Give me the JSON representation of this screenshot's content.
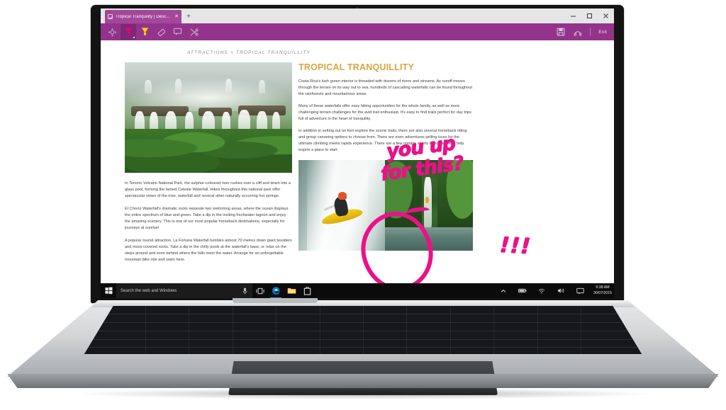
{
  "browser": {
    "tab": {
      "title": "Tropical Tranquility | Desc...",
      "favicon_icon": "page-favicon-icon",
      "close_icon": "close-icon"
    },
    "new_tab_label": "+",
    "window_controls": [
      {
        "name": "minimize",
        "icon": "minimize-icon"
      },
      {
        "name": "maximize",
        "icon": "maximize-icon"
      },
      {
        "name": "close",
        "icon": "close-icon"
      }
    ],
    "ink_toolbar": {
      "tools": [
        {
          "name": "touch-writing",
          "icon": "touch-writing-icon",
          "active": false
        },
        {
          "name": "pen",
          "icon": "pen-icon",
          "active": true,
          "color": "#e5007e"
        },
        {
          "name": "highlighter",
          "icon": "highlighter-icon",
          "active": false,
          "color": "#f4d400"
        },
        {
          "name": "eraser",
          "icon": "eraser-icon",
          "active": false
        },
        {
          "name": "add-note",
          "icon": "note-icon",
          "active": false
        },
        {
          "name": "clip",
          "icon": "clip-icon",
          "active": false
        }
      ],
      "save_icon": "save-icon",
      "share_icon": "share-icon",
      "exit_label": "Exit",
      "bar_color": "#93348c"
    }
  },
  "page": {
    "breadcrumb": "ATTRACTIONS  >  TROPICAL TRANQUILLITY",
    "title": "TROPICAL TRANQUILLITY",
    "title_color": "#d9a441",
    "hero_image_alt": "panoramic tropical waterfalls in rainforest",
    "right_paragraphs": [
      "Costa Rica's lush green interior is threaded with dozens of rivers and streams. As runoff moves through the terrain on its way out to sea, hundreds of cascading waterfalls can be found throughout the rainforests and mountainous areas.",
      "Many of these waterfalls offer easy hiking opportunities for the whole family, as well as more challenging terrain challenges for the avid trail enthusiast. It's easy to find trails perfect for day trips full of adventure in the heart of tranquility.",
      "In addition to setting out on foot explore the scenic trails, there are also several horseback riding and group canoeing options to choose from. There are even adventures pelling tours for the ultimate climbing meets rapids experience. There are a few notable sports listed bellow to help inspire a place to start"
    ],
    "left_paragraphs": [
      "In Tenorio Volcano National Park, the sulphur-coloured river rushes over a cliff and down into a glass pool, forming the famed Celeste Waterfall. Hikes throughout this national park offer spectacular views of the river, waterfall and several other naturally occurring hot springs.",
      "El Chorro Waterfall's dramatic rocks separate two swimming areas, where the ocean displays the entire spectrum of blue and green. Take a dip in the inviting freshwater lagoon and enjoy the amazing scenery. This is one of our most popular horseback destinations, especially for journeys at sunrise!",
      "A popular tourist attraction, La Fortuna Waterfall tumbles almost 70 metres down giant boulders and moss-covered rocks. Take a dip in the chilly pools at the waterfall's base, or relax on the steps around and even behind where the falls meet the water. Arrange for an unforgettable mountain bike ride and swim here."
    ],
    "photos": [
      {
        "name": "kayaker-waterfall-photo",
        "alt": "kayaker dropping over a waterfall"
      },
      {
        "name": "gorge-waterfall-photo",
        "alt": "waterfall in a green gorge"
      }
    ]
  },
  "annotations": {
    "ink_color": "#ec1089",
    "line1": "you up",
    "line2": "for this?",
    "exclaims": "!!!",
    "circle_name": "ink-circle-around-kayaker"
  },
  "taskbar": {
    "start_icon": "windows-start-icon",
    "search_placeholder": "Search the web and Windows",
    "mic_icon": "microphone-icon",
    "task_view_icon": "task-view-icon",
    "apps": [
      {
        "name": "edge",
        "icon": "edge-icon",
        "open": true
      },
      {
        "name": "file-explorer",
        "icon": "folder-icon",
        "open": false
      },
      {
        "name": "store",
        "icon": "store-icon",
        "open": false
      }
    ],
    "tray": [
      {
        "name": "show-hidden-icons",
        "icon": "chevron-up-icon"
      },
      {
        "name": "battery",
        "icon": "battery-icon"
      },
      {
        "name": "network",
        "icon": "wifi-icon"
      },
      {
        "name": "volume",
        "icon": "speaker-icon"
      },
      {
        "name": "action-center",
        "icon": "action-center-icon"
      }
    ],
    "time": "6:38 AM",
    "date": "30/07/2015"
  }
}
